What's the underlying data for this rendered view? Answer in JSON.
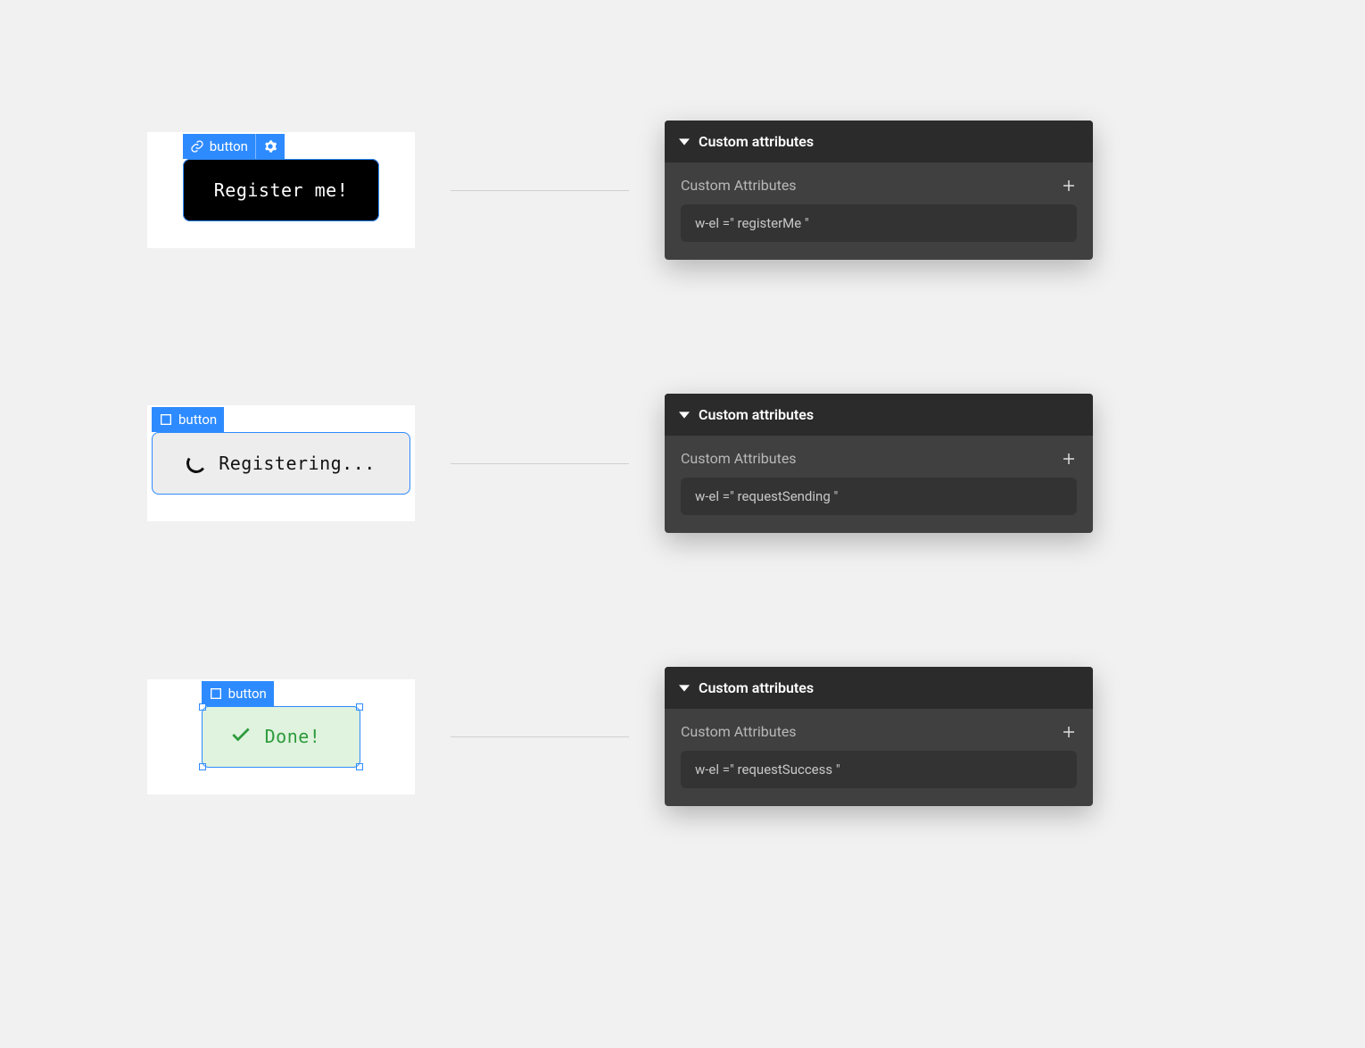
{
  "rows": [
    {
      "tag_label": "button",
      "tag_icons": [
        "link",
        "gear"
      ],
      "button_text": "Register me!",
      "button_variant": "register",
      "has_handles": false,
      "panel": {
        "header": "Custom attributes",
        "sub_label": "Custom Attributes",
        "attr_text": "w-el =\" registerMe \""
      }
    },
    {
      "tag_label": "button",
      "tag_icons": [
        "square"
      ],
      "button_text": "Registering...",
      "button_variant": "sending",
      "has_handles": false,
      "panel": {
        "header": "Custom attributes",
        "sub_label": "Custom Attributes",
        "attr_text": "w-el =\" requestSending \""
      }
    },
    {
      "tag_label": "button",
      "tag_icons": [
        "square"
      ],
      "button_text": "Done!",
      "button_variant": "done",
      "has_handles": true,
      "panel": {
        "header": "Custom attributes",
        "sub_label": "Custom Attributes",
        "attr_text": "w-el =\" requestSuccess \""
      }
    }
  ]
}
